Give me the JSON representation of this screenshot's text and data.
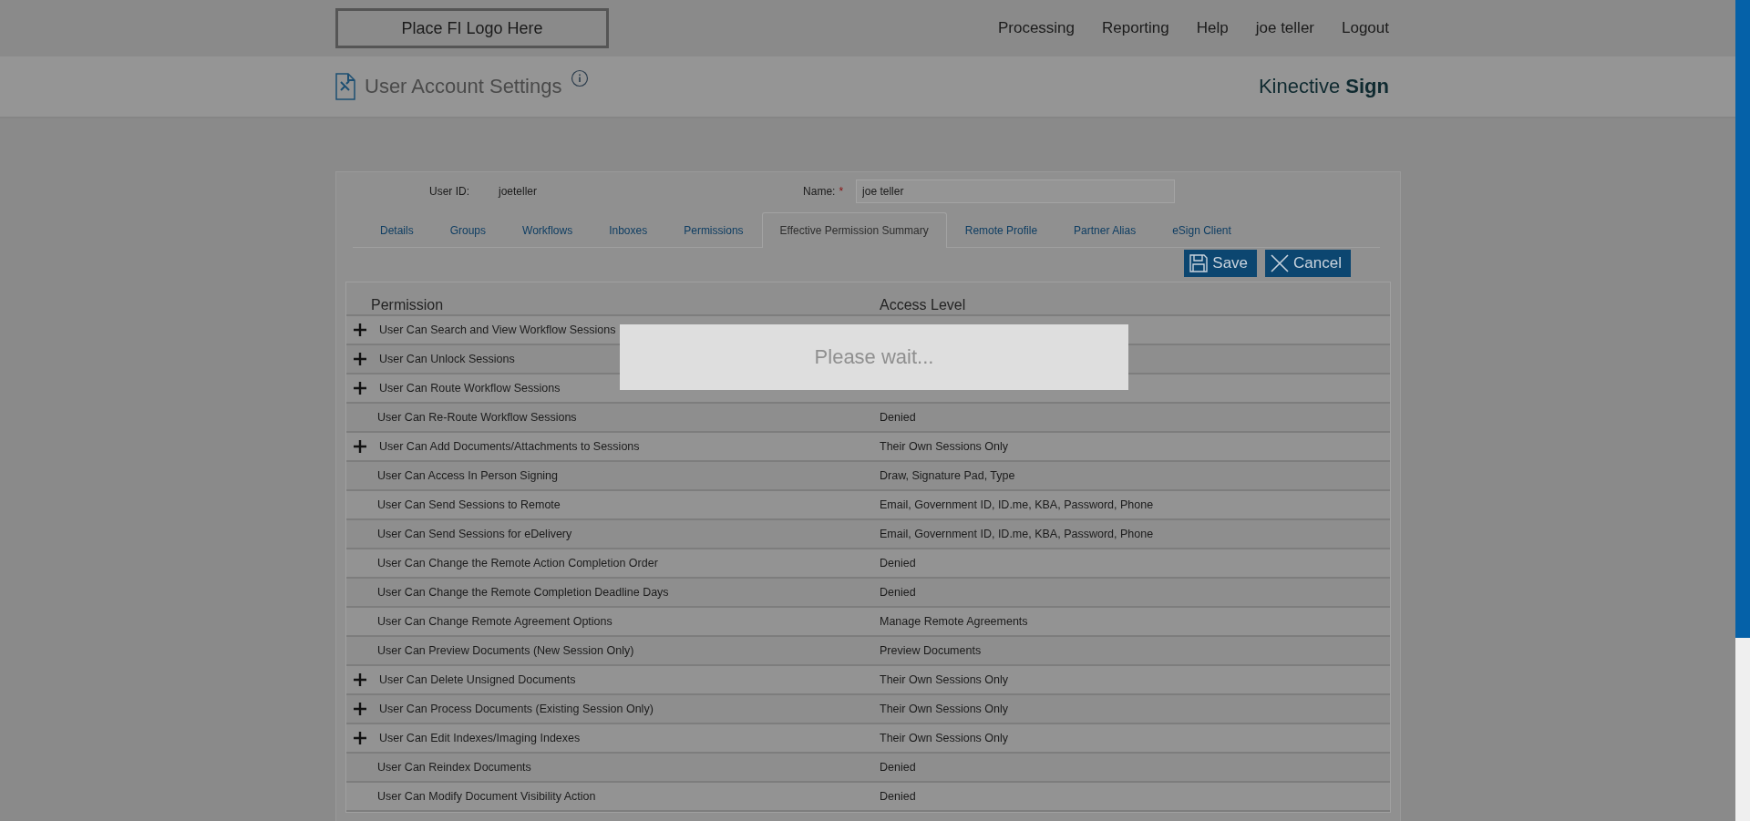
{
  "header": {
    "logo": "Place FI Logo Here",
    "nav": [
      "Processing",
      "Reporting",
      "Help",
      "joe teller",
      "Logout"
    ]
  },
  "page": {
    "title": "User Account Settings",
    "brand": "Kinective **Sign**"
  },
  "user": {
    "id_label": "User ID:",
    "id_value": "joeteller",
    "name_label": "Name:",
    "required_mark": "*",
    "name_value": "joe teller"
  },
  "tabs": [
    {
      "label": "Details",
      "selected": false
    },
    {
      "label": "Groups",
      "selected": false
    },
    {
      "label": "Workflows",
      "selected": false
    },
    {
      "label": "Inboxes",
      "selected": false
    },
    {
      "label": "Permissions",
      "selected": false
    },
    {
      "label": "Effective Permission Summary",
      "selected": true
    },
    {
      "label": "Remote Profile",
      "selected": false
    },
    {
      "label": "Partner Alias",
      "selected": false
    },
    {
      "label": "eSign Client",
      "selected": false
    }
  ],
  "buttons": [
    {
      "kind": "save",
      "label": "Save"
    },
    {
      "kind": "cancel",
      "label": "Cancel"
    }
  ],
  "table": {
    "columns": [
      "Permission",
      "Access Level"
    ],
    "rows": [
      {
        "permission": "User Can Search and View Workflow Sessions",
        "expandable": true
      },
      {
        "permission": "User Can Unlock Sessions",
        "expandable": true
      },
      {
        "permission": "User Can Route Workflow Sessions",
        "expandable": true
      },
      {
        "permission": "User Can Re-Route Workflow Sessions",
        "access": "Denied",
        "expandable": false
      },
      {
        "permission": "User Can Add Documents/Attachments to Sessions",
        "access": "Their Own Sessions Only",
        "expandable": true
      },
      {
        "permission": "User Can Access In Person Signing",
        "access": "Draw, Signature Pad, Type",
        "expandable": false
      },
      {
        "permission": "User Can Send Sessions to Remote",
        "access": "Email, Government ID, ID.me, KBA, Password, Phone",
        "expandable": false
      },
      {
        "permission": "User Can Send Sessions for eDelivery",
        "access": "Email, Government ID, ID.me, KBA, Password, Phone",
        "expandable": false
      },
      {
        "permission": "User Can Change the Remote Action Completion Order",
        "access": "Denied",
        "expandable": false
      },
      {
        "permission": "User Can Change the Remote Completion Deadline Days",
        "access": "Denied",
        "expandable": false
      },
      {
        "permission": "User Can Change Remote Agreement Options",
        "access": "Manage Remote Agreements",
        "expandable": false
      },
      {
        "permission": "User Can Preview Documents (New Session Only)",
        "access": "Preview Documents",
        "expandable": false
      },
      {
        "permission": "User Can Delete Unsigned Documents",
        "access": "Their Own Sessions Only",
        "expandable": true
      },
      {
        "permission": "User Can Process Documents (Existing Session Only)",
        "access": "Their Own Sessions Only",
        "expandable": true
      },
      {
        "permission": "User Can Edit Indexes/Imaging Indexes",
        "access": "Their Own Sessions Only",
        "expandable": true
      },
      {
        "permission": "User Can Reindex Documents",
        "access": "Denied",
        "expandable": false
      },
      {
        "permission": "User Can Modify Document Visibility Action",
        "access": "Denied",
        "expandable": false
      }
    ]
  },
  "loading": {
    "message": "Please wait..."
  }
}
